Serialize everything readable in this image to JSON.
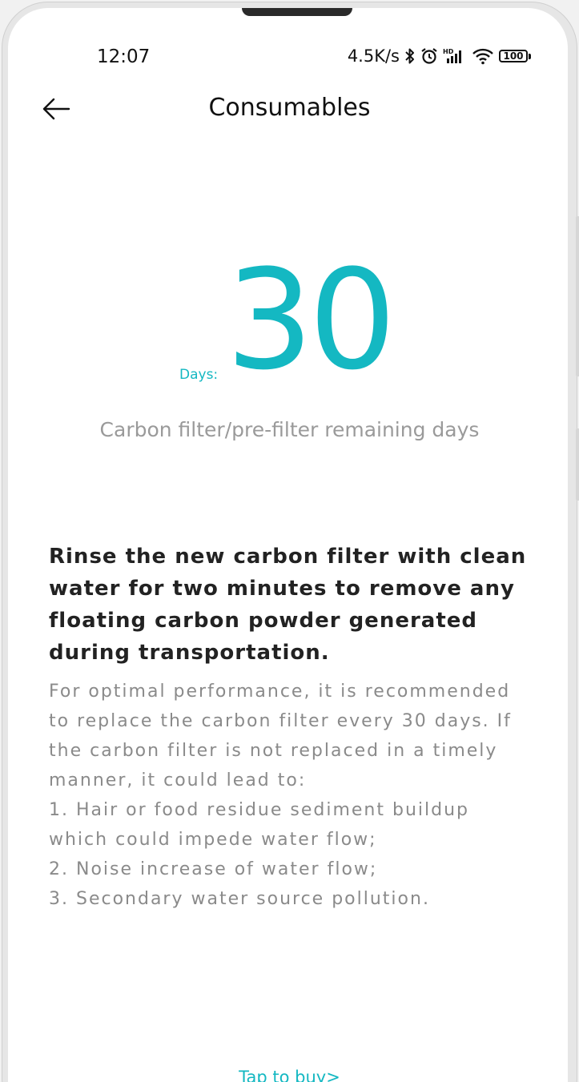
{
  "status_bar": {
    "time": "12:07",
    "network_speed": "4.5K/s",
    "battery": "100",
    "icons": [
      "bluetooth-icon",
      "alarm-icon",
      "hd-signal-icon",
      "wifi-icon",
      "battery-icon"
    ]
  },
  "header": {
    "title": "Consumables",
    "back_icon": "back-arrow-icon"
  },
  "filter": {
    "days_label": "Days:",
    "days_value": "30",
    "caption": "Carbon filter/pre-filter remaining days"
  },
  "notice": {
    "title": "Rinse the new carbon filter with clean water for two minutes to remove any floating carbon powder generated during transportation.",
    "body_intro": "For optimal performance, it is recommended to replace the carbon filter every 30 days. If the carbon filter is not replaced in a timely manner, it could lead to:",
    "items": [
      "1. Hair or food residue sediment buildup which could impede water flow;",
      "2. Noise increase of water flow;",
      "3. Secondary water source pollution."
    ]
  },
  "footer": {
    "buy_label": "Tap to buy>"
  },
  "colors": {
    "accent": "#14b8c2",
    "text_primary": "#111111",
    "text_secondary": "#8a8a8a"
  }
}
